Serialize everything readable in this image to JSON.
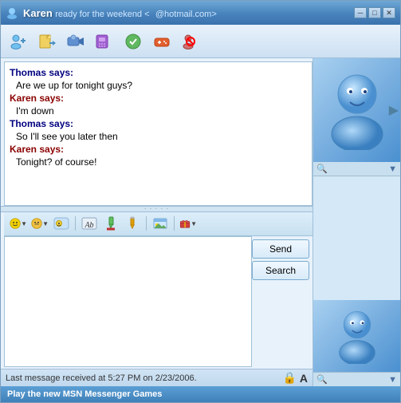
{
  "window": {
    "title": "Karen",
    "status": "ready for the weekend <",
    "email": "@hotmail.com>"
  },
  "titlebar": {
    "minimize_label": "─",
    "restore_label": "□",
    "close_label": "✕"
  },
  "chat": {
    "messages": [
      {
        "speaker": "Thomas",
        "type": "speaker",
        "text": "Thomas says:"
      },
      {
        "type": "message",
        "text": "Are we up for tonight guys?"
      },
      {
        "speaker": "Karen",
        "type": "speaker",
        "text": "Karen says:"
      },
      {
        "type": "message",
        "text": "I'm down"
      },
      {
        "speaker": "Thomas",
        "type": "speaker",
        "text": "Thomas says:"
      },
      {
        "type": "message",
        "text": "So I'll see you later then"
      },
      {
        "speaker": "Karen",
        "type": "speaker",
        "text": "Karen says:"
      },
      {
        "type": "message",
        "text": "Tonight? of course!"
      }
    ]
  },
  "format_toolbar": {
    "emoji_btn": "😊",
    "nudge_btn": "😏",
    "wink_btn": "(😜)",
    "font_btn": "A",
    "color_btn": "✏",
    "draw_btn": "🖊",
    "bg_btn": "🖼",
    "gift_btn": "🎁"
  },
  "buttons": {
    "send_label": "Send",
    "search_label": "Search"
  },
  "status": {
    "message": "Last message received at 5:27 PM on 2/23/2006."
  },
  "footer": {
    "text": "Play the new MSN Messenger Games"
  },
  "toolbar_items": [
    {
      "name": "add-contact",
      "title": "Add"
    },
    {
      "name": "send-file",
      "title": "File"
    },
    {
      "name": "video-call",
      "title": "Video"
    },
    {
      "name": "audio-call",
      "title": "Audio"
    },
    {
      "name": "activities",
      "title": "Activities"
    },
    {
      "name": "games",
      "title": "Games"
    },
    {
      "name": "block",
      "title": "Block"
    }
  ]
}
